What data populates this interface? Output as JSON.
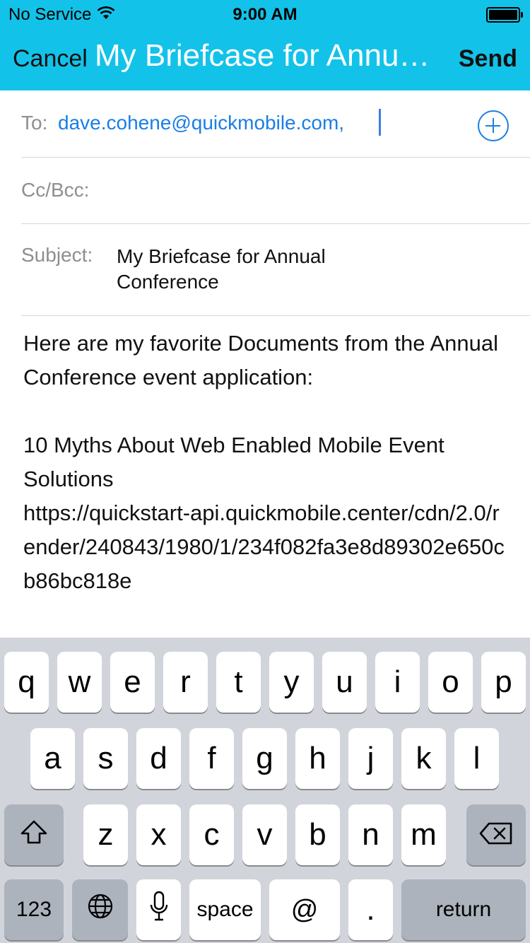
{
  "status_bar": {
    "carrier": "No Service",
    "time": "9:00 AM",
    "wifi_icon": "wifi-icon",
    "battery_icon": "battery-icon"
  },
  "nav": {
    "cancel_label": "Cancel",
    "title": "My Briefcase for Annual Conference",
    "send_label": "Send",
    "bar_color": "#13c2e8"
  },
  "compose": {
    "to_label": "To:",
    "to_address": "dave.cohene@quickmobile.com,",
    "cc_label": "Cc/Bcc:",
    "subject_label": "Subject:",
    "subject_value": "My Briefcase for Annual Conference",
    "body": {
      "intro": "Here are my favorite Documents from the Annual Conference event application:",
      "doc_title": "10 Myths About Web Enabled Mobile Event Solutions",
      "doc_url": "https://quickstart-api.quickmobile.center/cdn/2.0/render/240843/1980/1/234f082fa3e8d89302e650cb86bc818e"
    }
  },
  "keyboard": {
    "row1": [
      "q",
      "w",
      "e",
      "r",
      "t",
      "y",
      "u",
      "i",
      "o",
      "p"
    ],
    "row2": [
      "a",
      "s",
      "d",
      "f",
      "g",
      "h",
      "j",
      "k",
      "l"
    ],
    "row3": [
      "z",
      "x",
      "c",
      "v",
      "b",
      "n",
      "m"
    ],
    "numbers_label": "123",
    "globe_icon": "globe-icon",
    "mic_icon": "microphone-icon",
    "space_label": "space",
    "at_label": "@",
    "dot_label": ".",
    "return_label": "return",
    "shift_icon": "shift-icon",
    "delete_icon": "delete-icon"
  }
}
